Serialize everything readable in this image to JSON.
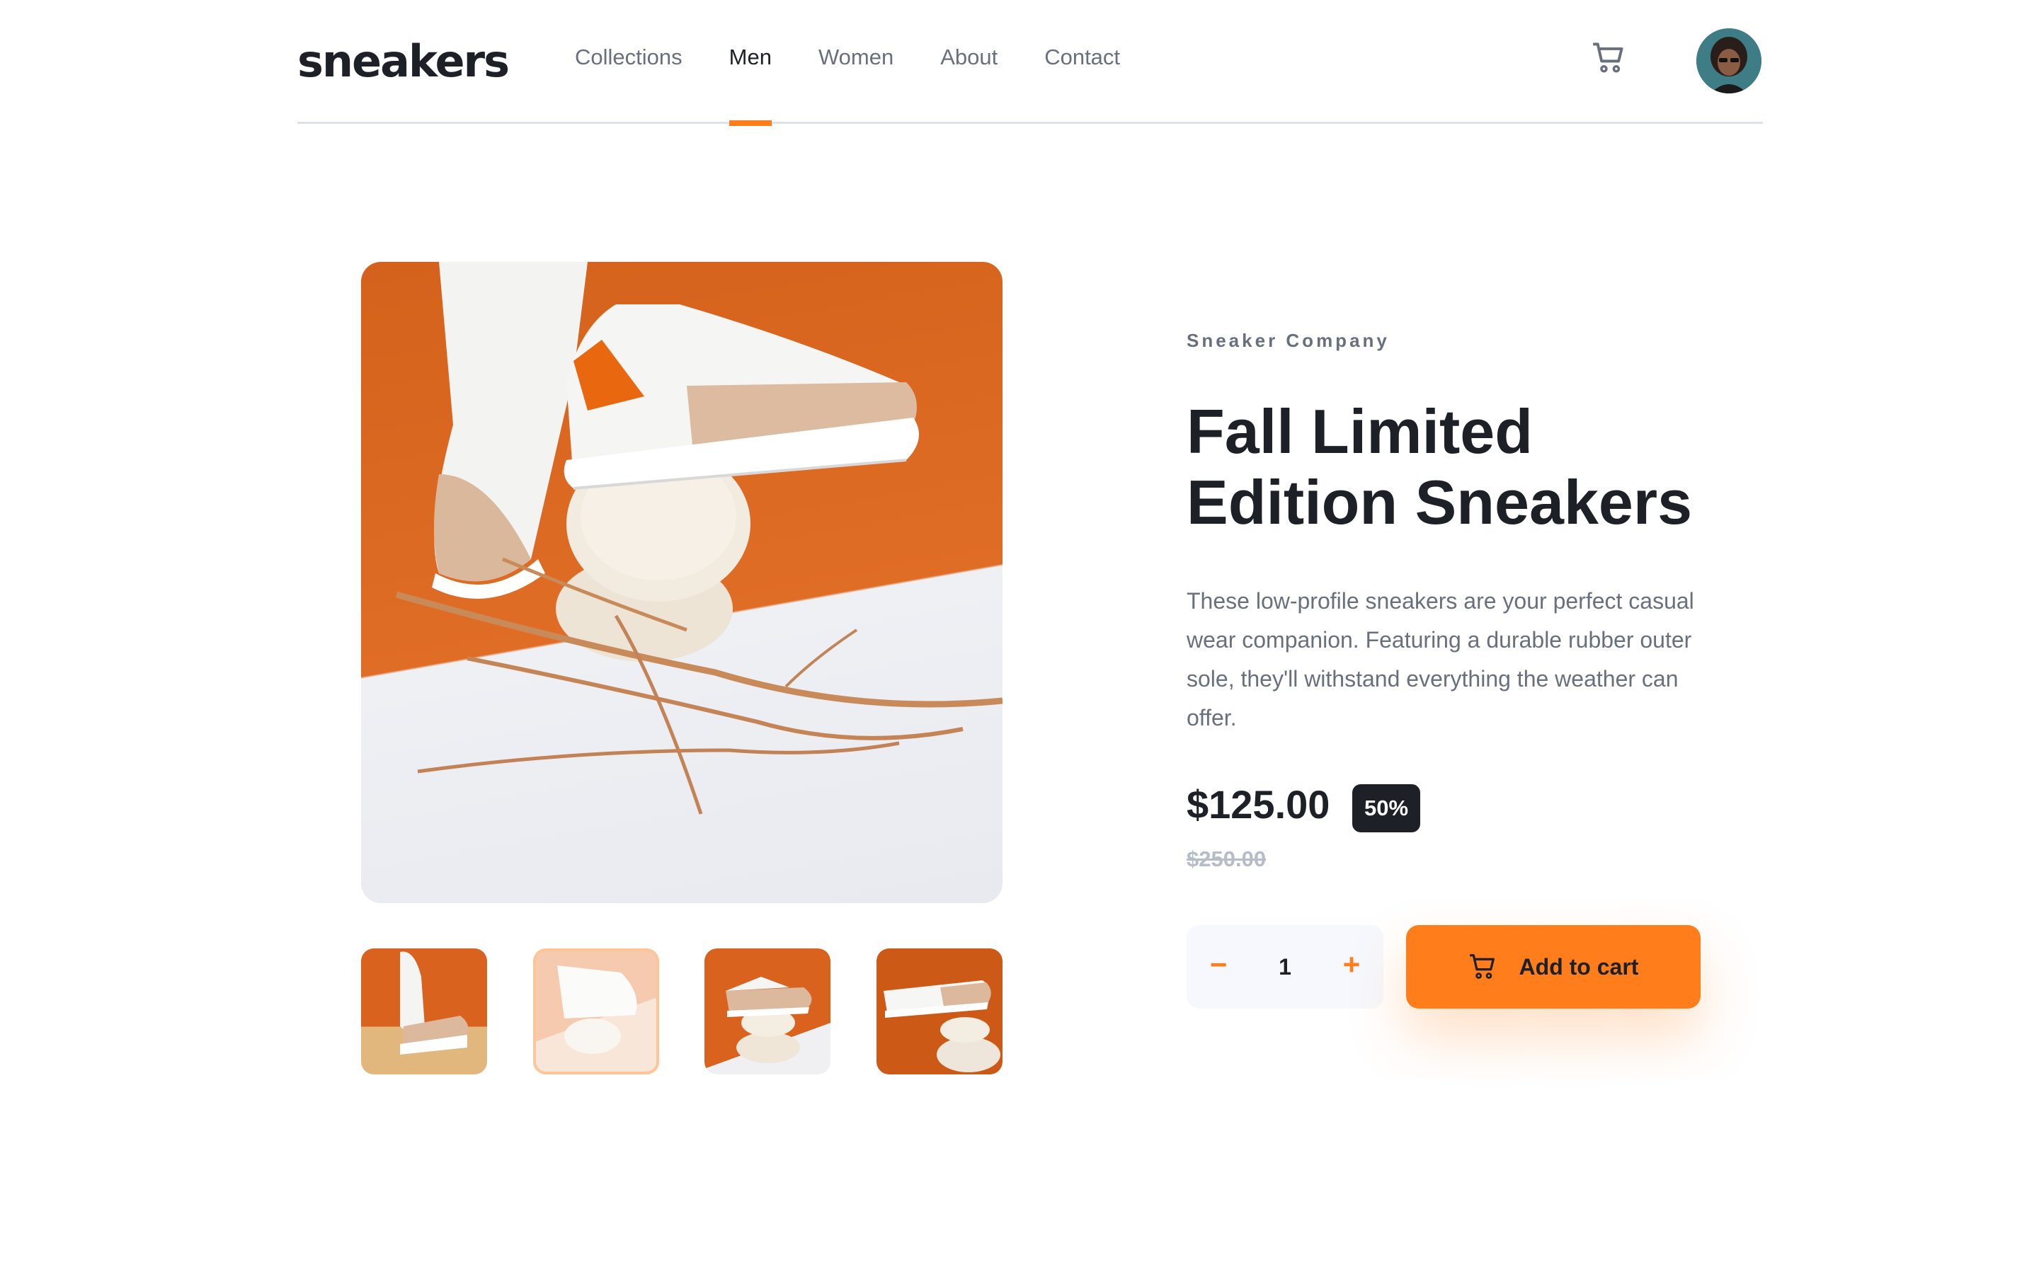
{
  "header": {
    "logo": "sneakers",
    "nav": [
      {
        "label": "Collections",
        "active": false
      },
      {
        "label": "Men",
        "active": true
      },
      {
        "label": "Women",
        "active": false
      },
      {
        "label": "About",
        "active": false
      },
      {
        "label": "Contact",
        "active": false
      }
    ],
    "cart_icon": "cart-icon",
    "avatar_icon": "avatar"
  },
  "gallery": {
    "thumbnails_count": 4,
    "selected_thumbnail": 2
  },
  "product": {
    "company": "Sneaker Company",
    "title": "Fall Limited Edition Sneakers",
    "description": "These low-profile sneakers are your perfect casual wear companion. Featuring a durable rubber outer sole, they'll withstand everything the weather can offer.",
    "price": "$125.00",
    "discount": "50%",
    "original_price": "$250.00"
  },
  "cart_controls": {
    "minus": "−",
    "quantity": "1",
    "plus": "+",
    "add_label": "Add to cart"
  },
  "colors": {
    "accent": "#ff7e1b",
    "dark": "#1d2026",
    "muted": "#69707d"
  }
}
